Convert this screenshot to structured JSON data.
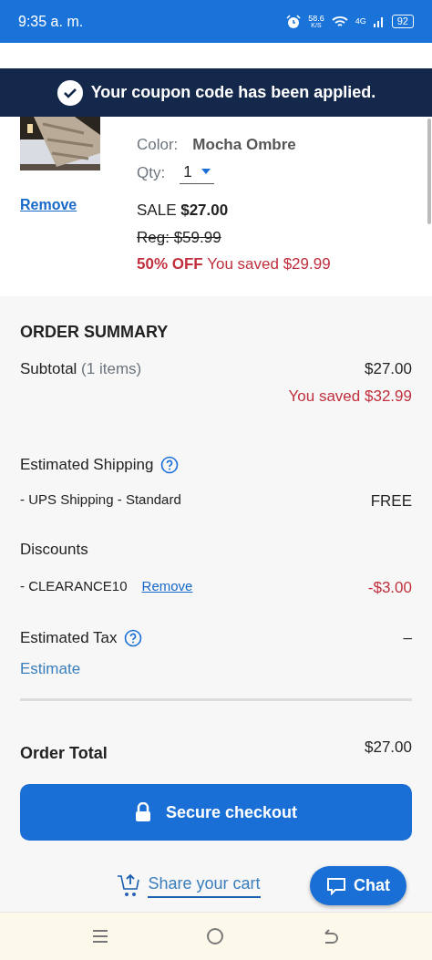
{
  "status_bar": {
    "time": "9:35 a. m.",
    "speed": "58.6",
    "speed_unit": "K/S",
    "network": "4G",
    "battery": "92"
  },
  "toast": {
    "message": "Your coupon code has been applied."
  },
  "item": {
    "kind": "picture",
    "color_label": "Color:",
    "color_value": "Mocha Ombre",
    "qty_label": "Qty:",
    "qty": "1",
    "remove": "Remove",
    "sale_label": "SALE",
    "sale_price": "$27.00",
    "regular": "Reg: $59.99",
    "off": "50% OFF",
    "saved": "You saved $29.99"
  },
  "summary": {
    "title": "ORDER SUMMARY",
    "subtotal": {
      "label": "Subtotal",
      "count": "(1 items)",
      "value": "$27.00",
      "saved": "You saved $32.99"
    },
    "shipping": {
      "label": "Estimated Shipping",
      "method": "- UPS Shipping - Standard",
      "value": "FREE"
    },
    "discounts": {
      "label": "Discounts",
      "code": "- CLEARANCE10",
      "remove": "Remove",
      "value": "-$3.00"
    },
    "tax": {
      "label": "Estimated Tax",
      "value": "–",
      "estimate": "Estimate"
    },
    "total": {
      "label": "Order Total",
      "value": "$27.00"
    },
    "checkout": "Secure checkout",
    "share": "Share your cart",
    "chat": "Chat"
  }
}
